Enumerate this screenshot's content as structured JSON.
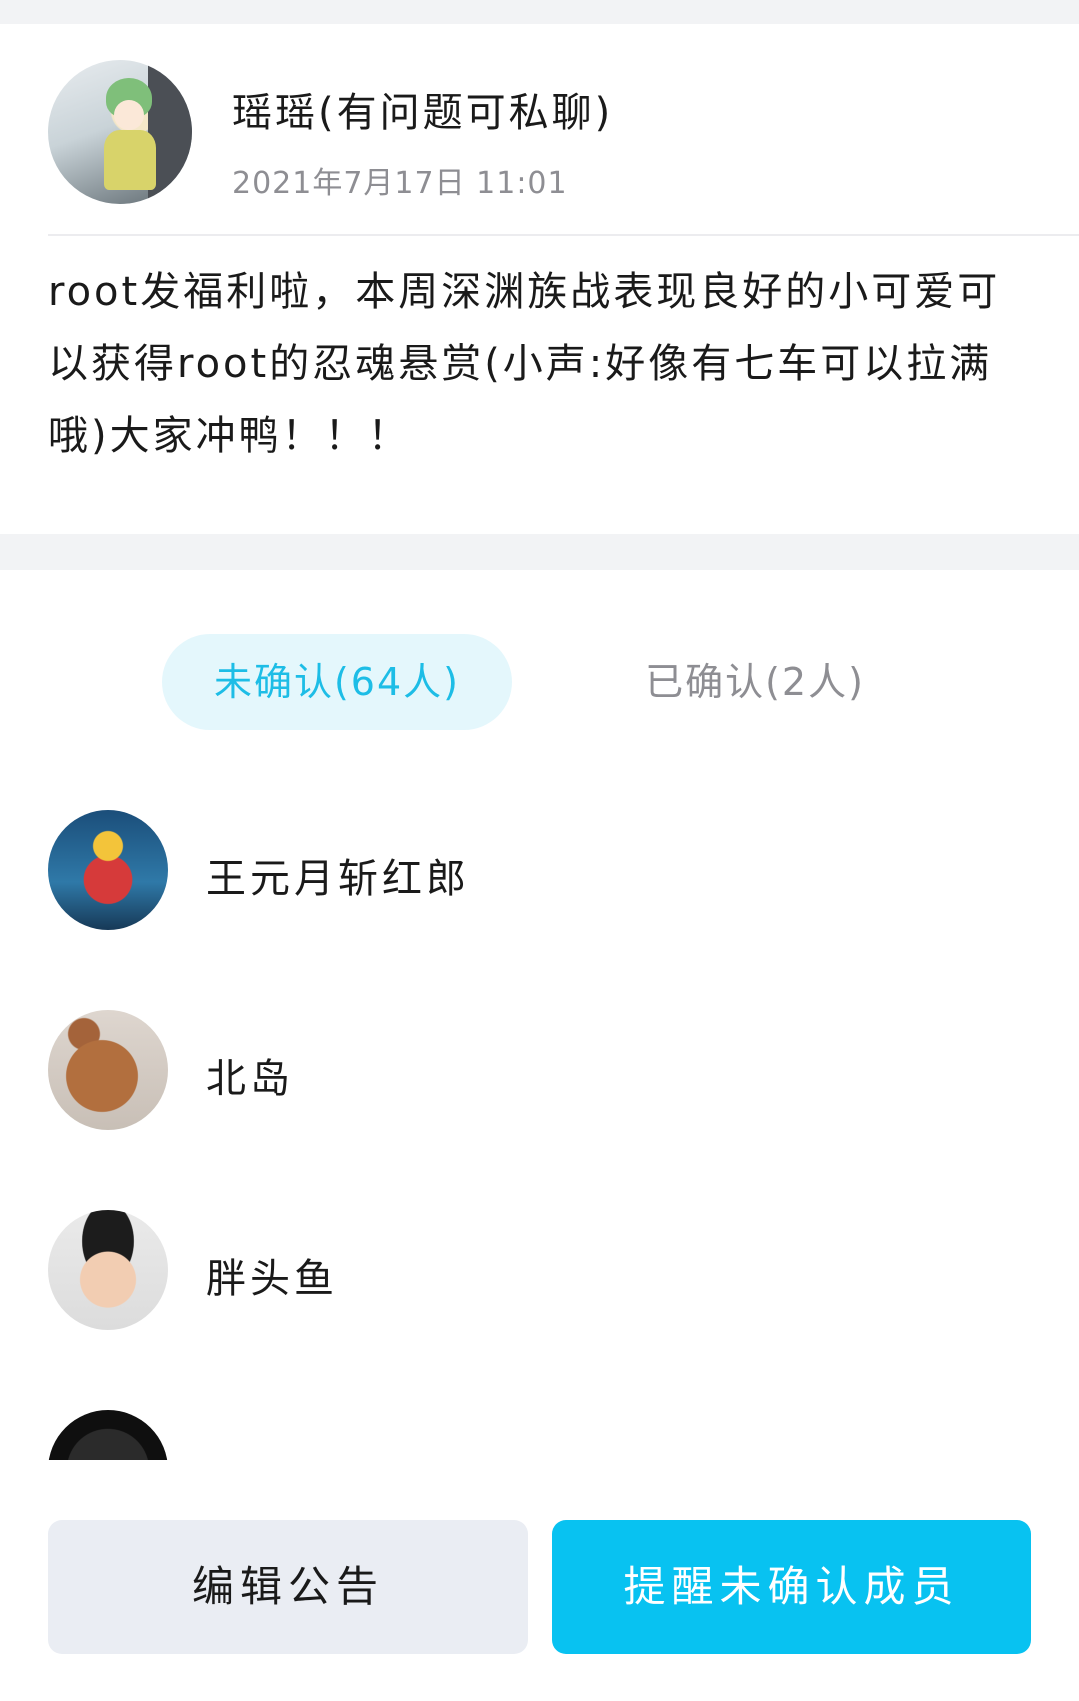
{
  "post": {
    "author_name": "瑶瑶(有问题可私聊)",
    "time": "2021年7月17日 11:01",
    "content": "root发福利啦，本周深渊族战表现良好的小可爱可以获得root的忍魂悬赏(小声:好像有七车可以拉满哦)大家冲鸭！！！"
  },
  "tabs": {
    "unconfirmed": "未确认(64人)",
    "confirmed": "已确认(2人)",
    "active": "unconfirmed"
  },
  "members": [
    {
      "name": "王元月斩红郎",
      "avatar": "ultraman-avatar"
    },
    {
      "name": "北岛",
      "avatar": "rabbit-avatar"
    },
    {
      "name": "胖头鱼",
      "avatar": "baby-avatar"
    },
    {
      "name": "",
      "avatar": "dark-avatar"
    }
  ],
  "actions": {
    "edit_label": "编辑公告",
    "remind_label": "提醒未确认成员"
  },
  "colors": {
    "accent": "#08c2f1",
    "tab_active_text": "#1dbde6",
    "tab_active_bg": "#e4f7fc",
    "secondary_text": "#8e8e93",
    "edit_button_bg": "#eaedf3"
  }
}
